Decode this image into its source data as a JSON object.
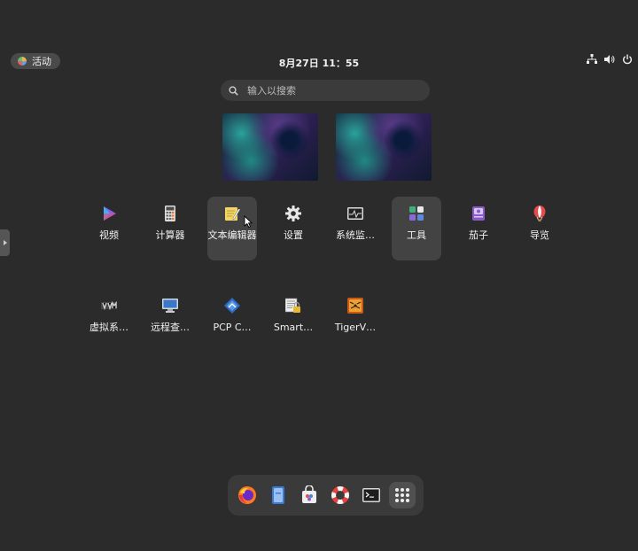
{
  "topbar": {
    "activities_label": "活动",
    "clock": "8月27日 11：55",
    "status_icons": [
      "network-icon",
      "volume-icon",
      "power-icon"
    ]
  },
  "search": {
    "placeholder": "输入以搜索",
    "value": ""
  },
  "workspaces": [
    "workspace-1",
    "workspace-2"
  ],
  "apps": {
    "videos": "视频",
    "calculator": "计算器",
    "text_editor": "文本编辑器",
    "settings": "设置",
    "system_monitor": "系统监…",
    "tools": "工具",
    "eggplant": "茄子",
    "tour": "导览",
    "virt_manager": "虚拟系…",
    "remote_viewer": "远程查…",
    "pcp": "PCP C…",
    "smartcard": "Smart…",
    "tigervnc": "TigerV…"
  },
  "dock": [
    "firefox-icon",
    "files-icon",
    "software-icon",
    "help-icon",
    "terminal-icon",
    "app-grid-icon"
  ]
}
